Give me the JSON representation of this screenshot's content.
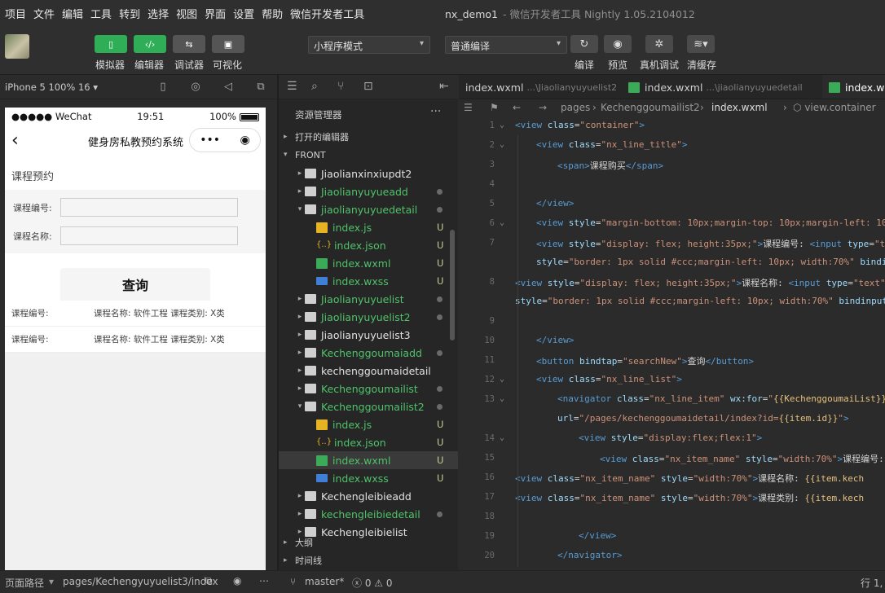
{
  "menubar": {
    "items": [
      "项目",
      "文件",
      "编辑",
      "工具",
      "转到",
      "选择",
      "视图",
      "界面",
      "设置",
      "帮助",
      "微信开发者工具"
    ],
    "title": "nx_demo1",
    "subtitle": "- 微信开发者工具 Nightly 1.05.2104012"
  },
  "toolbar": {
    "buttons": [
      {
        "label": "模拟器",
        "icon": "phone-icon"
      },
      {
        "label": "编辑器",
        "icon": "code-icon"
      },
      {
        "label": "调试器",
        "icon": "debug-icon"
      },
      {
        "label": "可视化",
        "icon": "layout-icon"
      }
    ],
    "mode_select": "小程序模式",
    "compile_select": "普通编译",
    "actions": [
      {
        "label": "编译",
        "icon": "refresh-icon"
      },
      {
        "label": "预览",
        "icon": "eye-icon"
      },
      {
        "label": "真机调试",
        "icon": "bug-icon"
      },
      {
        "label": "清缓存",
        "icon": "layers-icon"
      }
    ]
  },
  "simulator": {
    "device": "iPhone 5 100% 16 ▾",
    "status": {
      "carrier": "●●●●● WeChat",
      "time": "19:51",
      "battery": "100%"
    },
    "nav_title": "健身房私教预约系统",
    "capsule": {
      "more": "•••",
      "close": "◉"
    },
    "page_title": "课程预约",
    "form": [
      {
        "label": "课程编号:"
      },
      {
        "label": "课程名称:"
      }
    ],
    "query_button": "查询",
    "results": [
      {
        "col1": "课程编号:",
        "col2": "课程名称: 软件工程 课程类别: X类"
      },
      {
        "col1": "课程编号:",
        "col2": "课程名称: 软件工程 课程类别: X类"
      }
    ],
    "footer": {
      "label": "页面路径",
      "path": "pages/Kechengyuyuelist3/index"
    }
  },
  "explorer": {
    "title": "资源管理器",
    "more": "···",
    "open_editors": "打开的编辑器",
    "project": "FRONT",
    "tree": [
      {
        "name": "Jiaolianxinxiupdt2",
        "type": "folder",
        "color": "white",
        "arrow": "▸",
        "indent": 0
      },
      {
        "name": "Jiaolianyuyueadd",
        "type": "folder",
        "color": "green",
        "arrow": "▸",
        "indent": 0,
        "dot": true
      },
      {
        "name": "jiaolianyuyuedetail",
        "type": "folder",
        "color": "green",
        "arrow": "▾",
        "indent": 0,
        "dot": true
      },
      {
        "name": "index.js",
        "type": "js",
        "color": "green",
        "indent": 1,
        "badge": "U"
      },
      {
        "name": "index.json",
        "type": "json",
        "color": "green",
        "indent": 1,
        "badge": "U"
      },
      {
        "name": "index.wxml",
        "type": "wxml",
        "color": "green",
        "indent": 1,
        "badge": "U"
      },
      {
        "name": "index.wxss",
        "type": "wxss",
        "color": "green",
        "indent": 1,
        "badge": "U"
      },
      {
        "name": "Jiaolianyuyuelist",
        "type": "folder",
        "color": "green",
        "arrow": "▸",
        "indent": 0,
        "dot": true
      },
      {
        "name": "Jiaolianyuyuelist2",
        "type": "folder",
        "color": "green",
        "arrow": "▸",
        "indent": 0,
        "dot": true
      },
      {
        "name": "Jiaolianyuyuelist3",
        "type": "folder",
        "color": "white",
        "arrow": "▸",
        "indent": 0
      },
      {
        "name": "Kechenggoumaiadd",
        "type": "folder",
        "color": "green",
        "arrow": "▸",
        "indent": 0,
        "dot": true
      },
      {
        "name": "kechenggoumaidetail",
        "type": "folder",
        "color": "white",
        "arrow": "▸",
        "indent": 0
      },
      {
        "name": "Kechenggoumailist",
        "type": "folder",
        "color": "green",
        "arrow": "▸",
        "indent": 0,
        "dot": true
      },
      {
        "name": "Kechenggoumailist2",
        "type": "folder",
        "color": "green",
        "arrow": "▾",
        "indent": 0,
        "dot": true
      },
      {
        "name": "index.js",
        "type": "js",
        "color": "green",
        "indent": 1,
        "badge": "U"
      },
      {
        "name": "index.json",
        "type": "json",
        "color": "green",
        "indent": 1,
        "badge": "U"
      },
      {
        "name": "index.wxml",
        "type": "wxml",
        "color": "green",
        "indent": 1,
        "badge": "U",
        "selected": true
      },
      {
        "name": "index.wxss",
        "type": "wxss",
        "color": "green",
        "indent": 1,
        "badge": "U"
      },
      {
        "name": "Kechengleibieadd",
        "type": "folder",
        "color": "white",
        "arrow": "▸",
        "indent": 0
      },
      {
        "name": "kechengleibiedetail",
        "type": "folder",
        "color": "green",
        "arrow": "▸",
        "indent": 0,
        "dot": true
      },
      {
        "name": "Kechengleibielist",
        "type": "folder",
        "color": "white",
        "arrow": "▸",
        "indent": 0
      }
    ],
    "outline": "大纲",
    "timeline": "时间线"
  },
  "editor": {
    "tabs": [
      {
        "name": "index.wxml",
        "path": "...\\Jiaolianyuyuelist2"
      },
      {
        "name": "index.wxml",
        "path": "...\\jiaolianyuyuedetail"
      },
      {
        "name": "index.wx",
        "path": "",
        "active": true
      }
    ],
    "breadcrumb": [
      "pages",
      "Kechenggoumailist2",
      "index.wxml",
      "view.container"
    ],
    "lines": [
      {
        "n": "1",
        "fold": true,
        "indent": 0,
        "html": "<span class='t'>&lt;view</span> <span class='a'>class</span>=<span class='s'>\"container\"</span><span class='t'>&gt;</span>"
      },
      {
        "n": "2",
        "fold": true,
        "indent": 1,
        "html": "<span class='t'>&lt;view</span> <span class='a'>class</span>=<span class='s'>\"nx_line_title\"</span><span class='t'>&gt;</span>"
      },
      {
        "n": "3",
        "indent": 2,
        "html": "<span class='t'>&lt;span&gt;</span>课程购买<span class='t'>&lt;/span&gt;</span>"
      },
      {
        "n": "4",
        "indent": 0,
        "html": ""
      },
      {
        "n": "5",
        "indent": 1,
        "html": "<span class='t'>&lt;/view&gt;</span>"
      },
      {
        "n": "6",
        "fold": true,
        "indent": 1,
        "html": "<span class='t'>&lt;view</span> <span class='a'>style</span>=<span class='s'>\"margin-bottom: 10px;margin-top: 10px;margin-left: 10</span>"
      },
      {
        "n": "7",
        "indent": 1,
        "html": "<span class='t'>&lt;view</span> <span class='a'>style</span>=<span class='s'>\"display: flex; height:35px;\"</span><span class='t'>&gt;</span>课程编号: <span class='t'>&lt;input</span> <span class='a'>type</span>=<span class='s'>\"t</span>"
      },
      {
        "n": "",
        "indent": 1,
        "html": "<span class='a'>style</span>=<span class='s'>\"border: 1px solid #ccc;margin-left: 10px; width:70%\"</span> <span class='a'>bindi</span>"
      },
      {
        "n": "8",
        "indent": -1,
        "html": "<span class='t'>&lt;view</span> <span class='a'>style</span>=<span class='s'>\"display: flex; height:35px;\"</span><span class='t'>&gt;</span>课程名称: <span class='t'>&lt;input</span> <span class='a'>type</span>=<span class='s'>\"text\"</span>"
      },
      {
        "n": "",
        "indent": -1,
        "html": "<span class='a'>style</span>=<span class='s'>\"border: 1px solid #ccc;margin-left: 10px; width:70%\"</span> <span class='a'>bindinput</span>"
      },
      {
        "n": "9",
        "indent": 0,
        "html": ""
      },
      {
        "n": "10",
        "indent": 1,
        "html": "<span class='t'>&lt;/view&gt;</span>"
      },
      {
        "n": "11",
        "indent": 1,
        "html": "<span class='t'>&lt;button</span> <span class='a'>bindtap</span>=<span class='s'>\"searchNew\"</span><span class='t'>&gt;</span>查询<span class='t'>&lt;/button&gt;</span>"
      },
      {
        "n": "12",
        "fold": true,
        "indent": 1,
        "html": "<span class='t'>&lt;view</span> <span class='a'>class</span>=<span class='s'>\"nx_line_list\"</span><span class='t'>&gt;</span>"
      },
      {
        "n": "13",
        "fold": true,
        "indent": 2,
        "html": "<span class='t'>&lt;navigator</span> <span class='a'>class</span>=<span class='s'>\"nx_line_item\"</span> <span class='a'>wx:for</span>=<span class='s'>\"</span><span class='b'>{{KechenggoumaiList}}</span><span class='s'>\"</span>"
      },
      {
        "n": "",
        "indent": 2,
        "html": "<span class='a'>url</span>=<span class='s'>\"/pages/kechenggoumaidetail/index?id=</span><span class='b'>{{item.id}}</span><span class='s'>\"</span><span class='t'>&gt;</span>"
      },
      {
        "n": "14",
        "fold": true,
        "indent": 3,
        "html": "<span class='t'>&lt;view</span> <span class='a'>style</span>=<span class='s'>\"display:flex;flex:1\"</span><span class='t'>&gt;</span>"
      },
      {
        "n": "15",
        "indent": 4,
        "html": "<span class='t'>&lt;view</span> <span class='a'>class</span>=<span class='s'>\"nx_item_name\"</span> <span class='a'>style</span>=<span class='s'>\"width:70%\"</span><span class='t'>&gt;</span>课程编号:"
      },
      {
        "n": "16",
        "indent": -1,
        "html": "<span class='t'>&lt;view</span> <span class='a'>class</span>=<span class='s'>\"nx_item_name\"</span> <span class='a'>style</span>=<span class='s'>\"width:70%\"</span><span class='t'>&gt;</span>课程名称: <span class='b'>{{item.kech</span>"
      },
      {
        "n": "17",
        "indent": -1,
        "html": "<span class='t'>&lt;view</span> <span class='a'>class</span>=<span class='s'>\"nx_item_name\"</span> <span class='a'>style</span>=<span class='s'>\"width:70%\"</span><span class='t'>&gt;</span>课程类别: <span class='b'>{{item.kech</span>"
      },
      {
        "n": "18",
        "indent": 0,
        "html": ""
      },
      {
        "n": "19",
        "indent": 3,
        "html": "<span class='t'>&lt;/view&gt;</span>"
      },
      {
        "n": "20",
        "indent": 2,
        "html": "<span class='t'>&lt;/navigator&gt;</span>"
      }
    ]
  },
  "statusbar": {
    "branch": "master*",
    "errors": "ⓧ 0 ⚠ 0",
    "position": "行 1,"
  }
}
